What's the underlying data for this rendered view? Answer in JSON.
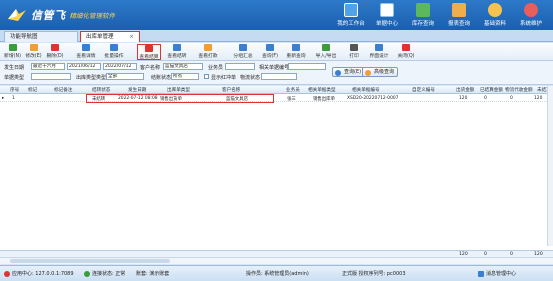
{
  "app": {
    "brand": "信管飞",
    "slogan": "精细化管理软件"
  },
  "topnav": [
    {
      "label": "我的工作台",
      "icon": "monitor-icon",
      "color": "#4fa3e6"
    },
    {
      "label": "单据中心",
      "icon": "document-icon",
      "color": "#8fc3ee"
    },
    {
      "label": "库存查询",
      "icon": "warehouse-icon",
      "color": "#5cb85c"
    },
    {
      "label": "报表查询",
      "icon": "bar-report-icon",
      "color": "#f0ad4e"
    },
    {
      "label": "基础资料",
      "icon": "user-icon",
      "color": "#f3c34e"
    },
    {
      "label": "系统维护",
      "icon": "settings-icon",
      "color": "#e95d5d"
    }
  ],
  "tabs": {
    "home": "功能导航图",
    "active": "出库单管理",
    "close": "×"
  },
  "toolbar": [
    {
      "label": "新增(N)",
      "icon": "add-icon",
      "color": "#3c9b3c",
      "highlight": false
    },
    {
      "label": "修改(E)",
      "icon": "edit-icon",
      "color": "#f0a030",
      "highlight": false
    },
    {
      "label": "删除(D)",
      "icon": "delete-icon",
      "color": "#d33",
      "highlight": false
    },
    {
      "label": "查看详情",
      "icon": "view-icon",
      "color": "#3a7fd0",
      "highlight": false
    },
    {
      "label": "批量操作",
      "icon": "batch-icon",
      "color": "#3a7fd0",
      "highlight": false
    },
    {
      "label": "查看结算",
      "icon": "settle-icon",
      "color": "#d33",
      "highlight": true
    },
    {
      "label": "查看结转",
      "icon": "transfer-icon",
      "color": "#3a7fd0",
      "highlight": false
    },
    {
      "label": "查看打款",
      "icon": "pay-icon",
      "color": "#f0a030",
      "highlight": false
    },
    {
      "label": "分组汇总",
      "icon": "group-icon",
      "color": "#3a7fd0",
      "highlight": false
    },
    {
      "label": "查询(F)",
      "icon": "search-icon",
      "color": "#3a7fd0",
      "highlight": false
    },
    {
      "label": "重新查询",
      "icon": "refresh-icon",
      "color": "#3a7fd0",
      "highlight": false
    },
    {
      "label": "导入/导出",
      "icon": "import-export-icon",
      "color": "#3c9b3c",
      "highlight": false
    },
    {
      "label": "打印",
      "icon": "print-icon",
      "color": "#555",
      "highlight": false
    },
    {
      "label": "界面设计",
      "icon": "design-icon",
      "color": "#3a7fd0",
      "highlight": false
    },
    {
      "label": "关闭(Q)",
      "icon": "close-icon",
      "color": "#d33",
      "highlight": false
    }
  ],
  "filters": {
    "date_label": "发生日期",
    "date_range": "最近十六月",
    "date_from": "2021/06/12",
    "date_to": "2022/07/12",
    "customer_label": "客户名称",
    "customer_value": "蓝猫文具店",
    "staff_label": "业务员",
    "staff_value": "",
    "source_no_label": "相关单据编号",
    "source_no_value": "",
    "bill_type_label": "单据类型",
    "bill_type_value": "",
    "outbound_type_label": "出库类型类型",
    "outbound_type_value": "全部",
    "settle_status_label": "结账状态",
    "settle_status_value": "所有",
    "show_red_label": "显示红冲单",
    "logistics_label": "物流状态",
    "logistics_value": "",
    "query_btn": "查询(E)",
    "advanced_btn": "高级查询"
  },
  "grid": {
    "headers": [
      "序号",
      "标记",
      "标记备注",
      "结转状态",
      "发生日期",
      "出库单类型",
      "客户名称",
      "业务员",
      "相关单据类型",
      "相关单据编号",
      "自定义编号",
      "出货金额",
      "已结算金额",
      "物流代收金额",
      "未结算"
    ],
    "rows": [
      [
        "1",
        "",
        "",
        "未结转",
        "2022-07-12 08:08",
        "销售出货单",
        "蓝猫文具店",
        "张三",
        "销售出库单",
        "XSD20-20220712-0007",
        "",
        "120",
        "0",
        "0",
        "120"
      ]
    ],
    "totals": {
      "amount": "120",
      "settled": "0",
      "logistics": "0",
      "unsettled": "120"
    }
  },
  "status": {
    "app_center": "应用中心: 127.0.0.1:7089",
    "conn_status": "连接状态: 正常",
    "account": "账套: 演示账套",
    "operator": "操作员: 系统管理员(admin)",
    "version": "正式版 授权序列号: pc0003",
    "message_center": "消息管理中心"
  }
}
